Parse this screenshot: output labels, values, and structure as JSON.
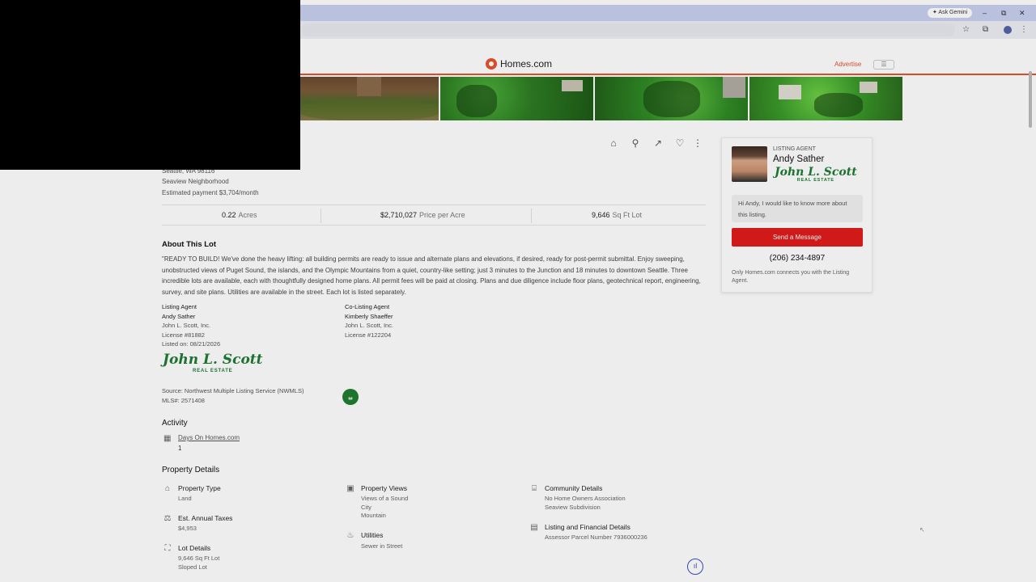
{
  "browser": {
    "ask_gemini": "✦ Ask Gemini",
    "minimize": "–",
    "maximize": "⧉",
    "close": "✕"
  },
  "header": {
    "site_name": "Homes.com",
    "advertise": "Advertise",
    "menu_icon": "☰"
  },
  "address": {
    "line_city": "Seattle, WA 98116",
    "neighborhood": "Seaview Neighborhood",
    "payment": "Estimated payment $3,704/month"
  },
  "stats": [
    {
      "value": "0.22",
      "unit": "Acres"
    },
    {
      "value": "$2,710,027",
      "unit": "Price per Acre"
    },
    {
      "value": "9,646",
      "unit": "Sq Ft Lot"
    }
  ],
  "about": {
    "title": "About This Lot",
    "description": "\"READY TO BUILD! We've done the heavy lifting: all building permits are ready to issue and alternate plans and elevations, if desired, ready for post-permit submittal. Enjoy sweeping, unobstructed views of Puget Sound, the islands, and the Olympic Mountains from a quiet, country-like setting; just 3 minutes to the Junction and 18 minutes to downtown Seattle. Three incredible lots are available, each with thoughtfully designed home plans. All permit fees will be paid at closing. Plans and due diligence include floor plans, geotechnical report, engineering, survey, and site plans. Utilities are available in the street. Each lot is listed separately."
  },
  "listing_agent": {
    "label": "Listing Agent",
    "name": "Andy Sather",
    "company": "John L. Scott, Inc.",
    "license": "License #81882",
    "listed_on": "Listed on: 08/21/2026"
  },
  "co_listing_agent": {
    "label": "Co-Listing Agent",
    "name": "Kimberly Shaeffer",
    "company": "John L. Scott, Inc.",
    "license": "License #122204"
  },
  "brokerage_logo": {
    "main": "John L. Scott",
    "sub": "REAL ESTATE"
  },
  "source": {
    "line1": "Source: Northwest Multiple Listing Service (NWMLS)",
    "line2": "MLS#: 2571408",
    "badge": "⧢"
  },
  "activity": {
    "title": "Activity",
    "days_label": "Days On Homes.com",
    "days_value": "1"
  },
  "property_details": {
    "title": "Property Details",
    "property_type": {
      "head": "Property Type",
      "values": [
        "Land"
      ]
    },
    "annual_taxes": {
      "head": "Est. Annual Taxes",
      "values": [
        "$4,953"
      ]
    },
    "lot_details": {
      "head": "Lot Details",
      "values": [
        "9,646 Sq Ft Lot",
        "Sloped Lot"
      ]
    },
    "views": {
      "head": "Property Views",
      "values": [
        "Views of a Sound",
        "City",
        "Mountain"
      ]
    },
    "utilities": {
      "head": "Utilities",
      "values": [
        "Sewer in Street"
      ]
    },
    "community": {
      "head": "Community Details",
      "values": [
        "No Home Owners Association",
        "Seaview Subdivision"
      ]
    },
    "financial": {
      "head": "Listing and Financial Details",
      "values": [
        "Assessor Parcel Number 7936000236"
      ]
    }
  },
  "agent_card": {
    "label": "LISTING AGENT",
    "name": "Andy Sather",
    "message": "Hi Andy, I would like to know more about this listing.",
    "send_button": "Send a Message",
    "phone": "(206) 234-4897",
    "note": "Only Homes.com connects you with the Listing Agent."
  },
  "colors": {
    "brand_orange": "#e8522d",
    "send_red": "#e01b1b",
    "jls_green": "#1e7b34"
  }
}
